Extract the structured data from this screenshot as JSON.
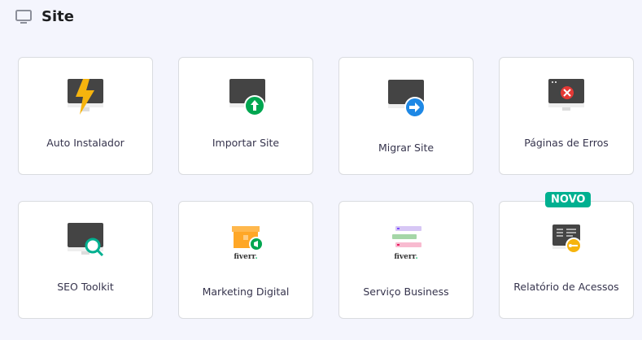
{
  "header": {
    "title": "Site",
    "icon": "monitor-icon"
  },
  "cards": [
    {
      "label": "Auto Instalador",
      "icon": "monitor-lightning-icon"
    },
    {
      "label": "Importar Site",
      "icon": "monitor-upload-icon"
    },
    {
      "label": "Migrar Site",
      "icon": "monitor-migrate-icon"
    },
    {
      "label": "Páginas de Erros",
      "icon": "monitor-error-icon"
    },
    {
      "label": "SEO Toolkit",
      "icon": "monitor-search-icon"
    },
    {
      "label": "Marketing Digital",
      "icon": "fiverr-store-icon",
      "logo": "fiverr."
    },
    {
      "label": "Serviço Business",
      "icon": "fiverr-list-icon",
      "logo": "fiverr."
    },
    {
      "label": "Relatório de Acessos",
      "icon": "monitor-key-icon",
      "badge": "NOVO"
    }
  ]
}
